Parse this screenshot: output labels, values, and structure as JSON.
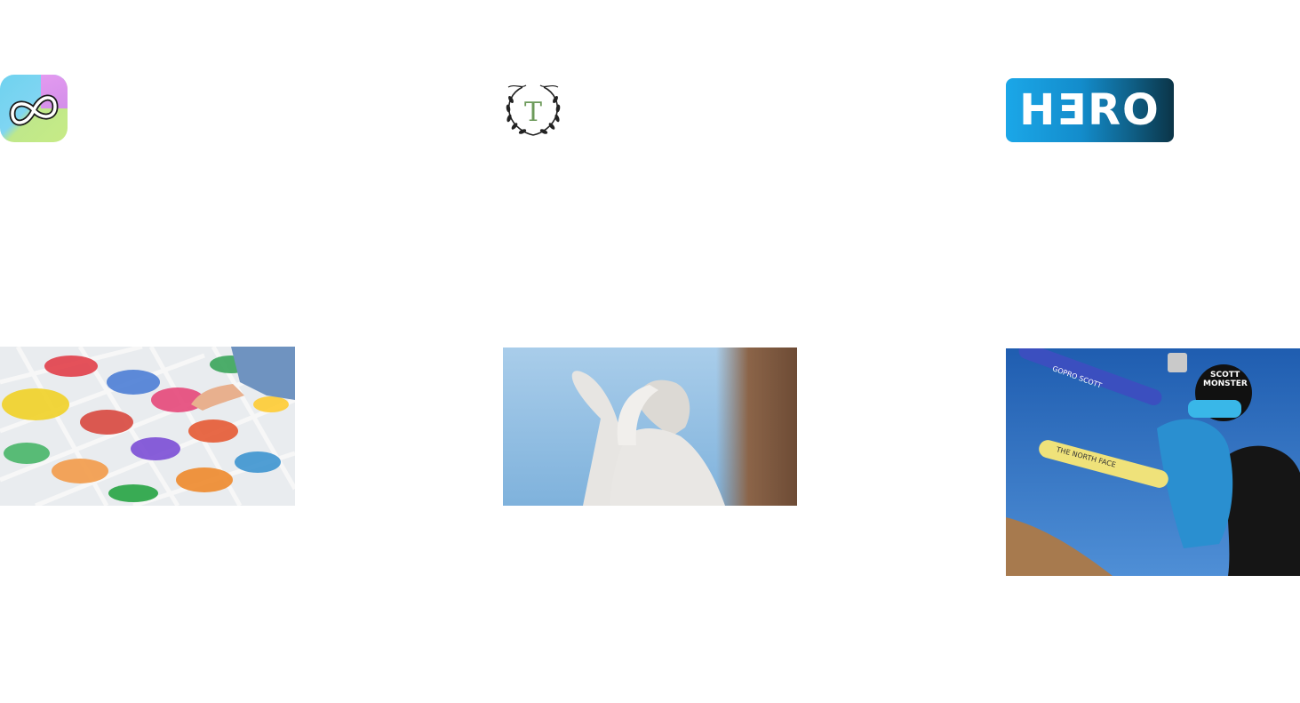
{
  "logos": {
    "infinity_app": {
      "icon": "infinity-icon",
      "colors": [
        "#7fd5f2",
        "#d38fe9",
        "#c7eb86"
      ]
    },
    "laurel_crest": {
      "letter": "T",
      "icon": "laurel-wreath-icon",
      "letter_color": "#6c9a5a"
    },
    "hero_brand": {
      "text": "HƎRO",
      "colors": [
        "#1ba7e8",
        "#0b3447"
      ]
    }
  },
  "photos": {
    "candy": {
      "subject": "candy-bins-photo"
    },
    "angel": {
      "subject": "angel-statue-photo"
    },
    "ski": {
      "subject": "skier-photo",
      "helmet_text": [
        "SCOTT",
        "MONSTER"
      ],
      "ski_text": [
        "GOPRO SCOTT",
        "THE NORTH FACE"
      ]
    }
  }
}
